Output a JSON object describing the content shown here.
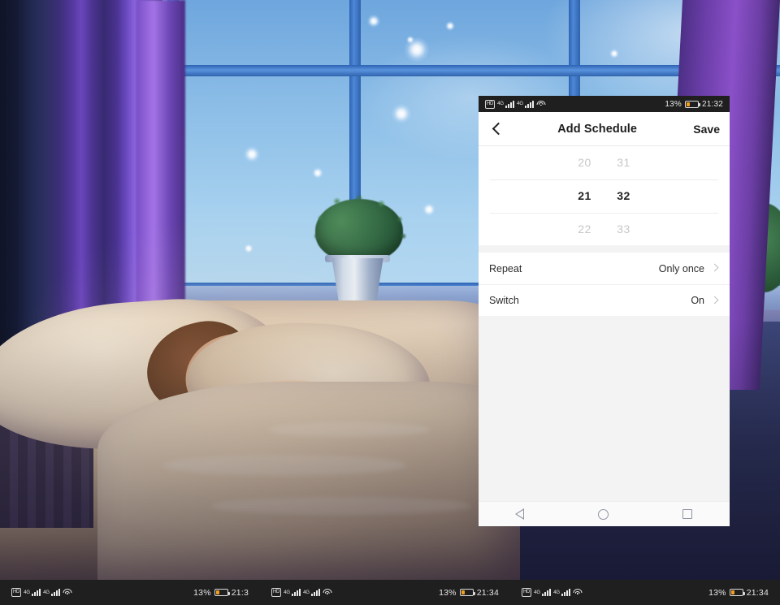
{
  "background": {
    "description": "bedroom-night-photo",
    "alt": "child sleeping in bed by a window with starry blue sky and purple curtains"
  },
  "phone": {
    "status_bar": {
      "hd_badge": "HD",
      "network_label_1": "4G",
      "network_label_2": "4G",
      "wifi_icon": "wifi-icon",
      "battery_percent": "13%",
      "battery_level": 13,
      "time": "21:32",
      "battery_color": "#f2a01e",
      "bar_bg": "#201f1f"
    },
    "app_bar": {
      "back_icon": "chevron-left-icon",
      "title": "Add Schedule",
      "action_label": "Save"
    },
    "time_picker": {
      "rows": [
        {
          "hour": "20",
          "minute": "31",
          "selected": false
        },
        {
          "hour": "21",
          "minute": "32",
          "selected": true
        },
        {
          "hour": "22",
          "minute": "33",
          "selected": false
        }
      ],
      "selected_time": "21:32"
    },
    "settings_rows": [
      {
        "label": "Repeat",
        "value": "Only once",
        "chevron": "chevron-right-icon"
      },
      {
        "label": "Switch",
        "value": "On",
        "chevron": "chevron-right-icon"
      }
    ],
    "nav_bar": {
      "back": "nav-back-triangle-icon",
      "home": "nav-home-circle-icon",
      "recents": "nav-recents-square-icon"
    }
  },
  "bottom_strips": [
    {
      "hd_badge": "HD",
      "network_label_1": "4G",
      "network_label_2": "4G",
      "battery_percent": "13%",
      "time": "21:3"
    },
    {
      "hd_badge": "HD",
      "network_label_1": "4G",
      "network_label_2": "4G",
      "battery_percent": "13%",
      "time": "21:34"
    },
    {
      "hd_badge": "HD",
      "network_label_1": "4G",
      "network_label_2": "4G",
      "battery_percent": "13%",
      "time": "21:34"
    }
  ]
}
